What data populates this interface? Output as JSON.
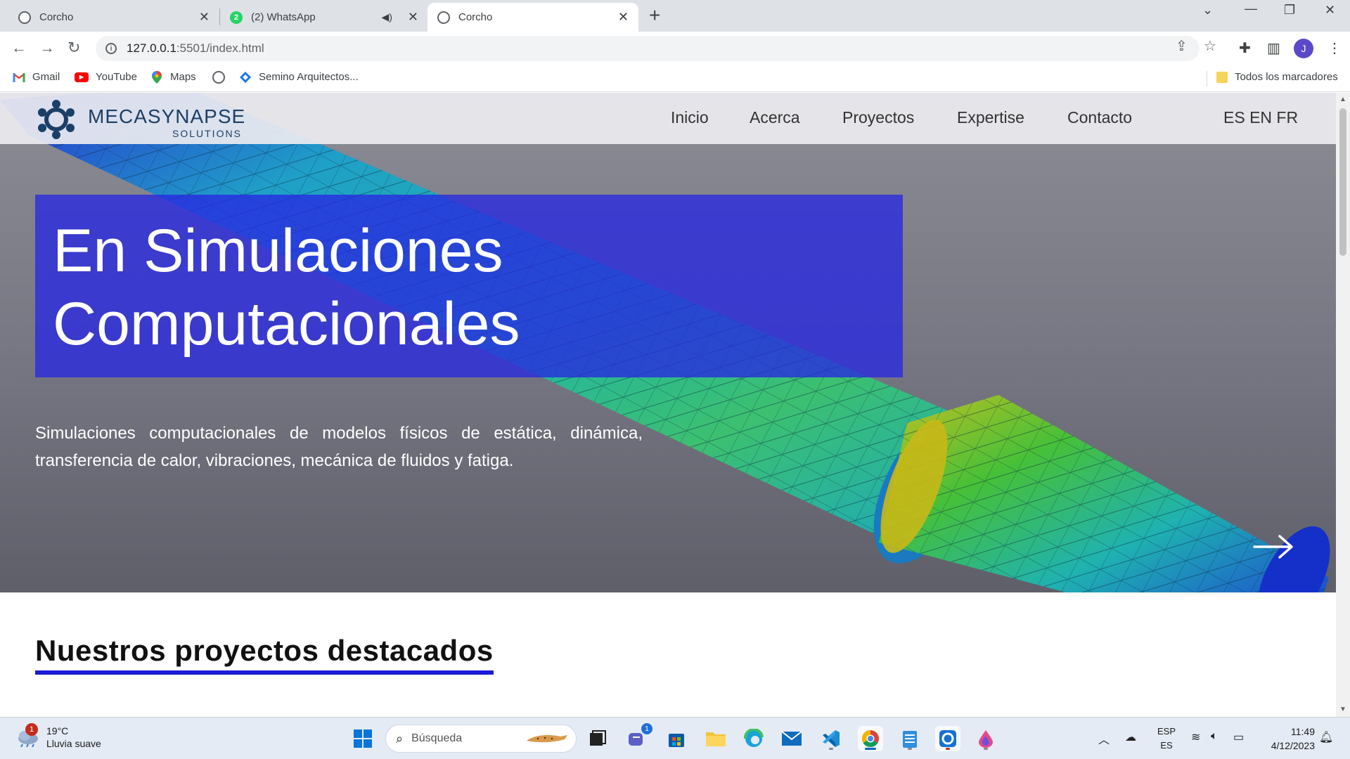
{
  "browser": {
    "tabs": [
      {
        "title": "Corcho",
        "favicon": "globe-icon"
      },
      {
        "title": "(2) WhatsApp",
        "favicon": "whatsapp-icon",
        "badge": "2"
      },
      {
        "title": "Corcho",
        "favicon": "globe-icon"
      }
    ],
    "address": {
      "host": "127.0.0.1",
      "path": ":5501/index.html"
    },
    "profile_initial": "J",
    "bookmarks": [
      {
        "label": "Gmail",
        "icon": "gmail-icon"
      },
      {
        "label": "YouTube",
        "icon": "youtube-icon"
      },
      {
        "label": "Maps",
        "icon": "maps-icon"
      },
      {
        "label": "",
        "icon": "globe-icon"
      },
      {
        "label": "Semino Arquitectos...",
        "icon": "diamond-icon"
      }
    ],
    "all_bookmarks": "Todos los marcadores"
  },
  "site": {
    "logo": {
      "name": "MECASYNAPSE",
      "sub": "SOLUTIONS"
    },
    "menu": [
      "Inicio",
      "Acerca",
      "Proyectos",
      "Expertise",
      "Contacto"
    ],
    "languages": "ES EN FR",
    "hero": {
      "headline_line1": "En Simulaciones",
      "headline_line2": "Computacionales",
      "description": "Simulaciones computacionales de modelos físicos de estática, dinámica, transferencia de calor, vibraciones, mecánica de fluidos y fatiga."
    },
    "section_title": "Nuestros proyectos destacados"
  },
  "taskbar": {
    "weather": {
      "temp": "19°C",
      "condition": "Lluvia suave",
      "badge": "1"
    },
    "search_placeholder": "Búsqueda",
    "teams_badge": "1",
    "lang_top": "ESP",
    "lang_bottom": "ES",
    "time": "11:49",
    "date": "4/12/2023"
  },
  "colors": {
    "headline_box": "#2828e1",
    "underline": "#1b1bd6",
    "logo": "#1c3f66"
  }
}
